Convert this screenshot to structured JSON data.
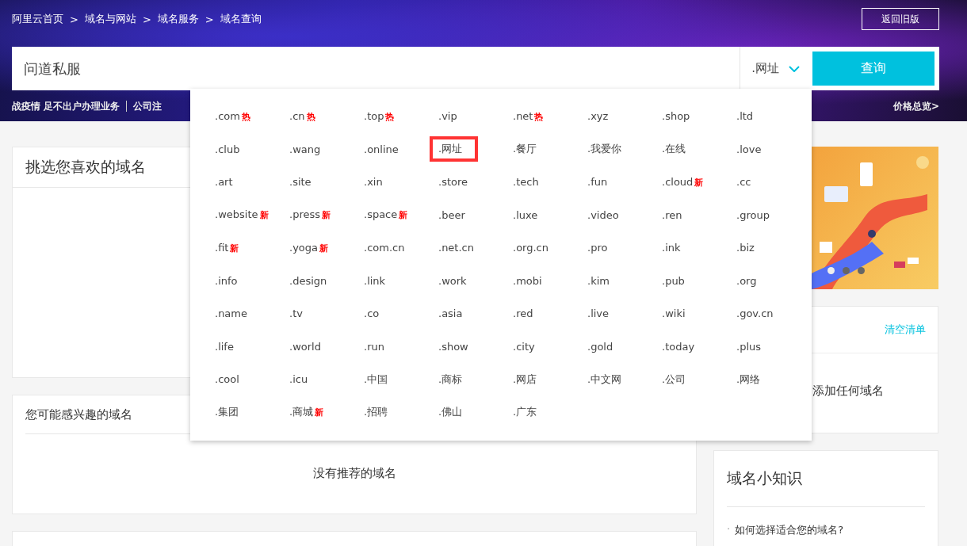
{
  "breadcrumb": [
    "阿里云首页",
    "域名与网站",
    "域名服务",
    "域名查询"
  ],
  "breadcrumb_separator": ">",
  "old_version_button": "返回旧版",
  "search": {
    "value": "问道私服",
    "suffix": ".网址",
    "button": "查询"
  },
  "promo_links": [
    "战疫情 足不出户办理业务",
    "公司注"
  ],
  "price_overview": "价格总览>",
  "suffix_dropdown": [
    {
      "label": ".com",
      "tag": "热",
      "selected": false
    },
    {
      "label": ".cn",
      "tag": "热",
      "selected": false
    },
    {
      "label": ".top",
      "tag": "热",
      "selected": false
    },
    {
      "label": ".vip",
      "selected": false
    },
    {
      "label": ".net",
      "tag": "热",
      "selected": false
    },
    {
      "label": ".xyz",
      "selected": false
    },
    {
      "label": ".shop",
      "selected": false
    },
    {
      "label": ".ltd",
      "selected": false
    },
    {
      "label": ".club",
      "selected": false
    },
    {
      "label": ".wang",
      "selected": false
    },
    {
      "label": ".online",
      "selected": false
    },
    {
      "label": ".网址",
      "selected": true
    },
    {
      "label": ".餐厅",
      "selected": false
    },
    {
      "label": ".我爱你",
      "selected": false
    },
    {
      "label": ".在线",
      "selected": false
    },
    {
      "label": ".love",
      "selected": false
    },
    {
      "label": ".art",
      "selected": false
    },
    {
      "label": ".site",
      "selected": false
    },
    {
      "label": ".xin",
      "selected": false
    },
    {
      "label": ".store",
      "selected": false
    },
    {
      "label": ".tech",
      "selected": false
    },
    {
      "label": ".fun",
      "selected": false
    },
    {
      "label": ".cloud",
      "tag": "新",
      "selected": false
    },
    {
      "label": ".cc",
      "selected": false
    },
    {
      "label": ".website",
      "tag": "新",
      "selected": false
    },
    {
      "label": ".press",
      "tag": "新",
      "selected": false
    },
    {
      "label": ".space",
      "tag": "新",
      "selected": false
    },
    {
      "label": ".beer",
      "selected": false
    },
    {
      "label": ".luxe",
      "selected": false
    },
    {
      "label": ".video",
      "selected": false
    },
    {
      "label": ".ren",
      "selected": false
    },
    {
      "label": ".group",
      "selected": false
    },
    {
      "label": ".fit",
      "tag": "新",
      "selected": false
    },
    {
      "label": ".yoga",
      "tag": "新",
      "selected": false
    },
    {
      "label": ".com.cn",
      "selected": false
    },
    {
      "label": ".net.cn",
      "selected": false
    },
    {
      "label": ".org.cn",
      "selected": false
    },
    {
      "label": ".pro",
      "selected": false
    },
    {
      "label": ".ink",
      "selected": false
    },
    {
      "label": ".biz",
      "selected": false
    },
    {
      "label": ".info",
      "selected": false
    },
    {
      "label": ".design",
      "selected": false
    },
    {
      "label": ".link",
      "selected": false
    },
    {
      "label": ".work",
      "selected": false
    },
    {
      "label": ".mobi",
      "selected": false
    },
    {
      "label": ".kim",
      "selected": false
    },
    {
      "label": ".pub",
      "selected": false
    },
    {
      "label": ".org",
      "selected": false
    },
    {
      "label": ".name",
      "selected": false
    },
    {
      "label": ".tv",
      "selected": false
    },
    {
      "label": ".co",
      "selected": false
    },
    {
      "label": ".asia",
      "selected": false
    },
    {
      "label": ".red",
      "selected": false
    },
    {
      "label": ".live",
      "selected": false
    },
    {
      "label": ".wiki",
      "selected": false
    },
    {
      "label": ".gov.cn",
      "selected": false
    },
    {
      "label": ".life",
      "selected": false
    },
    {
      "label": ".world",
      "selected": false
    },
    {
      "label": ".run",
      "selected": false
    },
    {
      "label": ".show",
      "selected": false
    },
    {
      "label": ".city",
      "selected": false
    },
    {
      "label": ".gold",
      "selected": false
    },
    {
      "label": ".today",
      "selected": false
    },
    {
      "label": ".plus",
      "selected": false
    },
    {
      "label": ".cool",
      "selected": false
    },
    {
      "label": ".icu",
      "selected": false
    },
    {
      "label": ".中国",
      "selected": false
    },
    {
      "label": ".商标",
      "selected": false
    },
    {
      "label": ".网店",
      "selected": false
    },
    {
      "label": ".中文网",
      "selected": false
    },
    {
      "label": ".公司",
      "selected": false
    },
    {
      "label": ".网络",
      "selected": false
    },
    {
      "label": ".集团",
      "selected": false
    },
    {
      "label": ".商城",
      "tag": "新",
      "selected": false
    },
    {
      "label": ".招聘",
      "selected": false
    },
    {
      "label": ".佛山",
      "selected": false
    },
    {
      "label": ".广东",
      "selected": false
    }
  ],
  "pick_card": {
    "title": "挑选您喜欢的域名"
  },
  "interest_card": {
    "title": "您可能感兴趣的域名",
    "empty": "没有推荐的域名"
  },
  "banner": {
    "kind": "picture",
    "dots": [
      {
        "selected": true
      },
      {
        "selected": false
      },
      {
        "selected": false
      }
    ]
  },
  "cart_card": {
    "clear_link": "清空清单",
    "empty": "添加任何域名"
  },
  "tips_card": {
    "title": "域名小知识",
    "items": [
      {
        "bullet": "·",
        "text": "如何选择适合您的域名?"
      }
    ]
  }
}
